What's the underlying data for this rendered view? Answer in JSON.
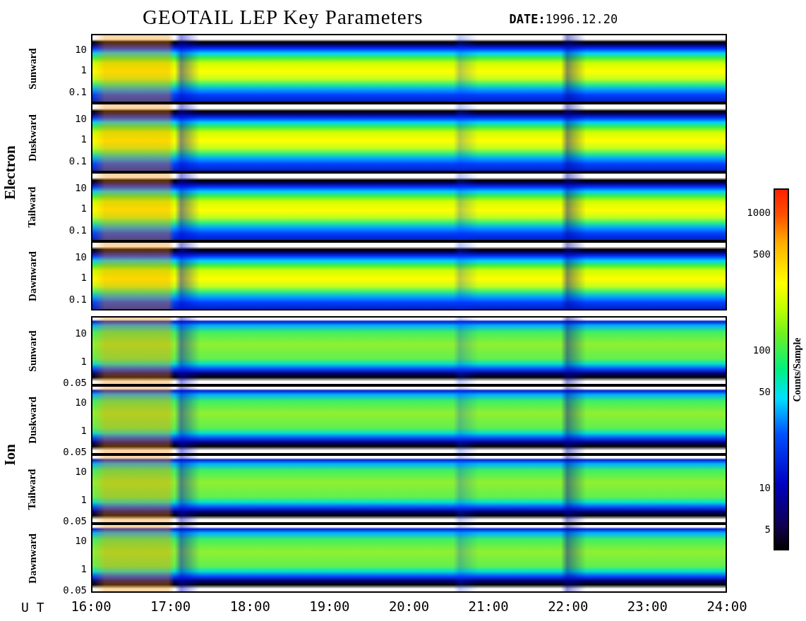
{
  "title": "GEOTAIL LEP Key Parameters",
  "date": "**DATE:**1996.12.20",
  "groups": [
    {
      "species": "Electron",
      "kind": "electron",
      "panels": [
        {
          "label": "Sunward",
          "ticks": [
            "10",
            "1",
            "0.1"
          ]
        },
        {
          "label": "Duskward",
          "ticks": [
            "10",
            "1",
            "0.1"
          ]
        },
        {
          "label": "Tailward",
          "ticks": [
            "10",
            "1",
            "0.1"
          ]
        },
        {
          "label": "Dawnward",
          "ticks": [
            "10",
            "1",
            "0.1"
          ]
        }
      ]
    },
    {
      "species": "Ion",
      "kind": "ion",
      "panels": [
        {
          "label": "Sunward",
          "ticks": [
            "10",
            "1",
            "0.05"
          ]
        },
        {
          "label": "Duskward",
          "ticks": [
            "10",
            "1",
            "0.05"
          ]
        },
        {
          "label": "Tailward",
          "ticks": [
            "10",
            "1",
            "0.05"
          ]
        },
        {
          "label": "Dawnward",
          "ticks": [
            "10",
            "1",
            "0.05"
          ]
        }
      ]
    }
  ],
  "x_axis": {
    "label": "U T",
    "ticks": [
      "16:00",
      "17:00",
      "18:00",
      "19:00",
      "20:00",
      "21:00",
      "22:00",
      "23:00",
      "24:00"
    ]
  },
  "colorbar": {
    "title": "Counts/Sample",
    "ticks": [
      "1000",
      "500",
      "100",
      "50",
      "10",
      "5"
    ]
  }
}
